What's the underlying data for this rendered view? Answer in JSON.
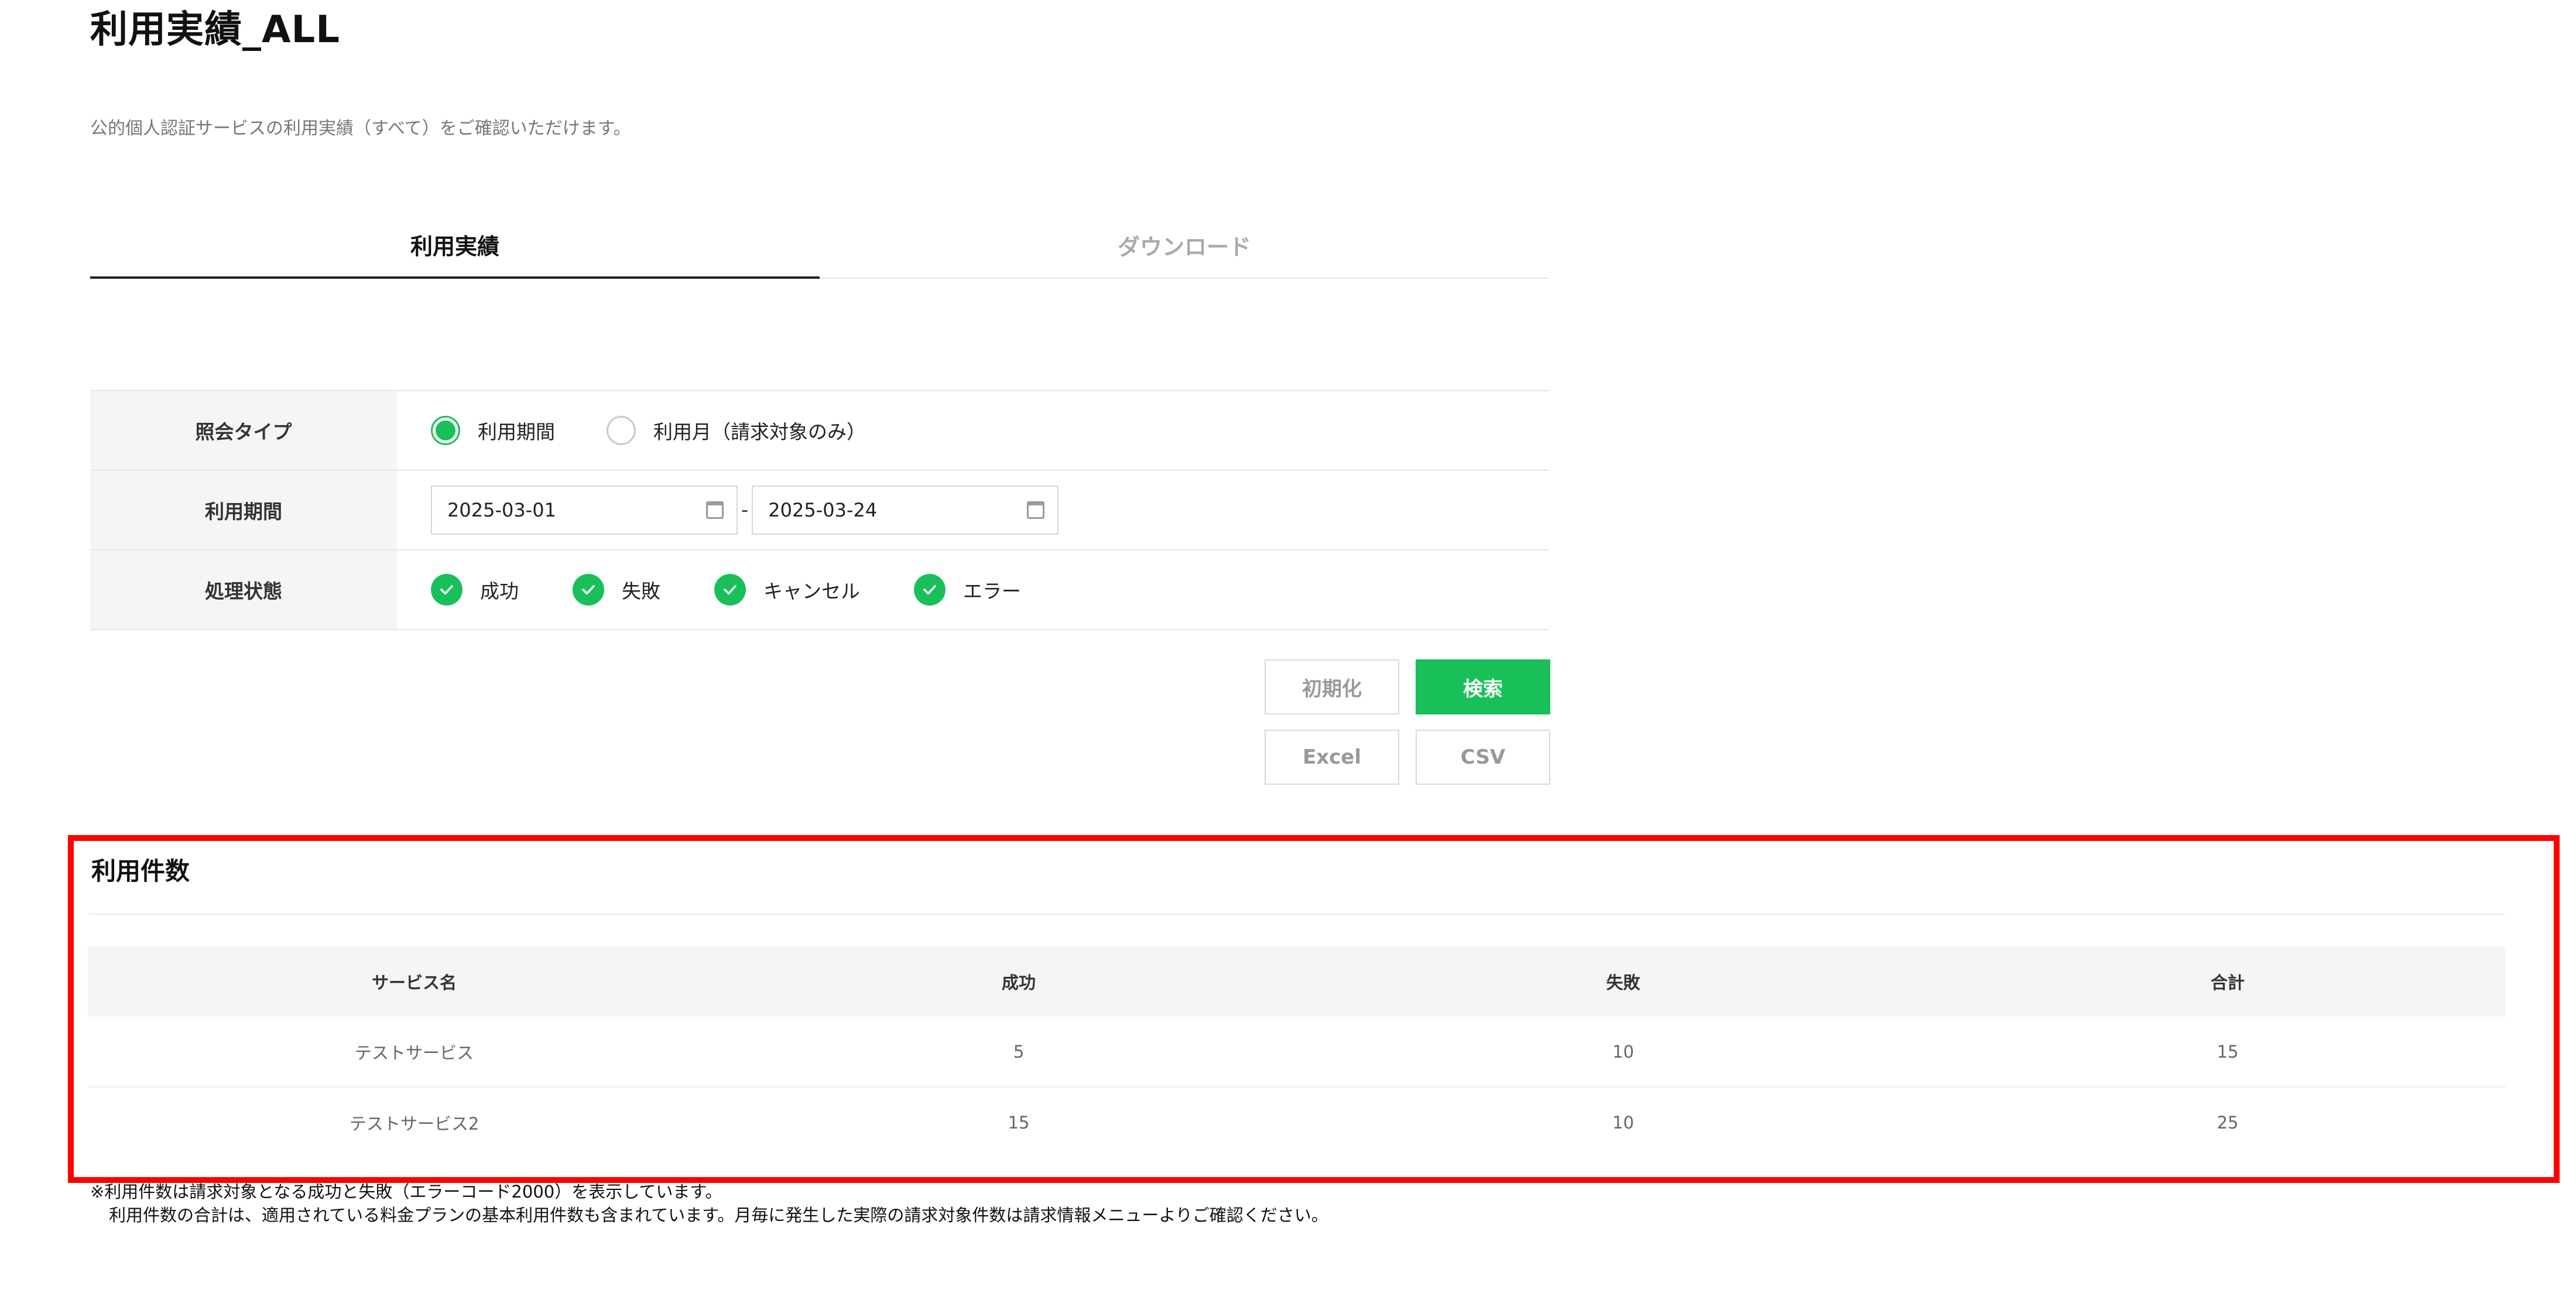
{
  "page": {
    "title": "利用実績_ALL",
    "description": "公的個人認証サービスの利用実績（すべて）をご確認いただけます。"
  },
  "tabs": [
    {
      "label": "利用実績",
      "active": true
    },
    {
      "label": "ダウンロード",
      "active": false
    }
  ],
  "form": {
    "query_type": {
      "label": "照会タイプ",
      "options": [
        {
          "label": "利用期間",
          "selected": true
        },
        {
          "label": "利用月（請求対象のみ）",
          "selected": false
        }
      ]
    },
    "period": {
      "label": "利用期間",
      "start": "2025-03-01",
      "separator": "-",
      "end": "2025-03-24"
    },
    "status": {
      "label": "処理状態",
      "options": [
        {
          "label": "成功",
          "checked": true
        },
        {
          "label": "失敗",
          "checked": true
        },
        {
          "label": "キャンセル",
          "checked": true
        },
        {
          "label": "エラー",
          "checked": true
        }
      ]
    }
  },
  "buttons": {
    "reset": "初期化",
    "search": "検索",
    "excel": "Excel",
    "csv": "CSV"
  },
  "usage": {
    "title": "利用件数",
    "headers": [
      "サービス名",
      "成功",
      "失敗",
      "合計"
    ],
    "rows": [
      [
        "テストサービス",
        "5",
        "10",
        "15"
      ],
      [
        "テストサービス2",
        "15",
        "10",
        "25"
      ]
    ]
  },
  "notes": [
    "※利用件数は請求対象となる成功と失敗（エラーコード2000）を表示しています。",
    "利用件数の合計は、適用されている料金プランの基本利用件数も含まれています。月毎に発生した実際の請求対象件数は請求情報メニューよりご確認ください。"
  ],
  "colors": {
    "accent": "#19c05a",
    "highlight": "#ff0000",
    "header_bg": "#f5f5f7"
  }
}
